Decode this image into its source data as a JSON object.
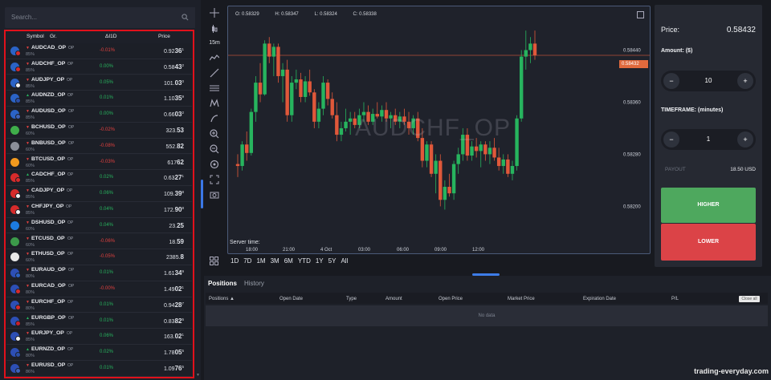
{
  "search": {
    "placeholder": "Search..."
  },
  "list_header": {
    "symbol": "Symbol",
    "group": "Gr.",
    "change": "ΔI1D",
    "price": "Price"
  },
  "assets": [
    {
      "symbol": "AUDCAD_OP",
      "suffix": "OP",
      "payout": "85%",
      "dir": "down",
      "change": "-0.01%",
      "price_main": "0.92",
      "price_big": "36",
      "price_sup": "1",
      "c1": "#2b63c6",
      "c2": "#d62b2b"
    },
    {
      "symbol": "AUDCHF_OP",
      "suffix": "OP",
      "payout": "85%",
      "dir": "down",
      "change": "0.00%",
      "price_main": "0.58",
      "price_big": "43",
      "price_sup": "2",
      "c1": "#2b63c6",
      "c2": "#d62b2b"
    },
    {
      "symbol": "AUDJPY_OP",
      "suffix": "OP",
      "payout": "85%",
      "dir": "down",
      "change": "0.05%",
      "price_main": "101.",
      "price_big": "03",
      "price_sup": "0",
      "c1": "#2b63c6",
      "c2": "#f2f2f2"
    },
    {
      "symbol": "AUDNZD_OP",
      "suffix": "OP",
      "payout": "85%",
      "dir": "up",
      "change": "0.01%",
      "price_main": "1.10",
      "price_big": "35",
      "price_sup": "9",
      "c1": "#2b63c6",
      "c2": "#2b4fa8"
    },
    {
      "symbol": "AUDUSD_OP",
      "suffix": "OP",
      "payout": "85%",
      "dir": "down",
      "change": "0.00%",
      "price_main": "0.66",
      "price_big": "03",
      "price_sup": "2",
      "c1": "#2b63c6",
      "c2": "#3e62b8"
    },
    {
      "symbol": "BCHUSD_OP",
      "suffix": "OP",
      "payout": "60%",
      "dir": "down",
      "change": "-0.02%",
      "price_main": "323.",
      "price_big": "53",
      "price_sup": "",
      "c1": "#3fae4a",
      "c2": ""
    },
    {
      "symbol": "BNBUSD_OP",
      "suffix": "OP",
      "payout": "60%",
      "dir": "down",
      "change": "-0.08%",
      "price_main": "552.",
      "price_big": "82",
      "price_sup": "",
      "c1": "#8b8f99",
      "c2": ""
    },
    {
      "symbol": "BTCUSD_OP",
      "suffix": "OP",
      "payout": "60%",
      "dir": "down",
      "change": "-0.03%",
      "price_main": "617",
      "price_big": "62",
      "price_sup": "",
      "c1": "#f29a1e",
      "c2": ""
    },
    {
      "symbol": "CADCHF_OP",
      "suffix": "OP",
      "payout": "85%",
      "dir": "up",
      "change": "0.02%",
      "price_main": "0.63",
      "price_big": "27",
      "price_sup": "1",
      "c1": "#d62b2b",
      "c2": "#d62b2b"
    },
    {
      "symbol": "CADJPY_OP",
      "suffix": "OP",
      "payout": "85%",
      "dir": "down",
      "change": "0.06%",
      "price_main": "109.",
      "price_big": "39",
      "price_sup": "8",
      "c1": "#d62b2b",
      "c2": "#f2f2f2"
    },
    {
      "symbol": "CHFJPY_OP",
      "suffix": "OP",
      "payout": "85%",
      "dir": "down",
      "change": "0.04%",
      "price_main": "172.",
      "price_big": "90",
      "price_sup": "8",
      "c1": "#d62b2b",
      "c2": "#f2f2f2"
    },
    {
      "symbol": "DSHUSD_OP",
      "suffix": "OP",
      "payout": "60%",
      "dir": "down",
      "change": "0.04%",
      "price_main": "23.",
      "price_big": "25",
      "price_sup": "",
      "c1": "#1c7be0",
      "c2": ""
    },
    {
      "symbol": "ETCUSD_OP",
      "suffix": "OP",
      "payout": "60%",
      "dir": "down",
      "change": "-0.06%",
      "price_main": "18.",
      "price_big": "59",
      "price_sup": "",
      "c1": "#3c9a4a",
      "c2": ""
    },
    {
      "symbol": "ETHUSD_OP",
      "suffix": "OP",
      "payout": "60%",
      "dir": "down",
      "change": "-0.05%",
      "price_main": "2385.",
      "price_big": "8",
      "price_sup": "",
      "c1": "#e8e8e8",
      "c2": ""
    },
    {
      "symbol": "EURAUD_OP",
      "suffix": "OP",
      "payout": "80%",
      "dir": "down",
      "change": "0.01%",
      "price_main": "1.61",
      "price_big": "34",
      "price_sup": "9",
      "c1": "#2d4fb5",
      "c2": "#2b63c6"
    },
    {
      "symbol": "EURCAD_OP",
      "suffix": "OP",
      "payout": "80%",
      "dir": "down",
      "change": "-0.00%",
      "price_main": "1.49",
      "price_big": "02",
      "price_sup": "1",
      "c1": "#2d4fb5",
      "c2": "#d62b2b"
    },
    {
      "symbol": "EURCHF_OP",
      "suffix": "OP",
      "payout": "80%",
      "dir": "down",
      "change": "0.01%",
      "price_main": "0.94",
      "price_big": "28",
      "price_sup": "7",
      "c1": "#2d4fb5",
      "c2": "#d62b2b"
    },
    {
      "symbol": "EURGBP_OP",
      "suffix": "OP",
      "payout": "85%",
      "dir": "up",
      "change": "0.01%",
      "price_main": "0.83",
      "price_big": "82",
      "price_sup": "5",
      "c1": "#2d4fb5",
      "c2": "#c8202a"
    },
    {
      "symbol": "EURJPY_OP",
      "suffix": "OP",
      "payout": "85%",
      "dir": "down",
      "change": "0.06%",
      "price_main": "163.",
      "price_big": "02",
      "price_sup": "1",
      "c1": "#2d4fb5",
      "c2": "#f2f2f2"
    },
    {
      "symbol": "EURNZD_OP",
      "suffix": "OP",
      "payout": "80%",
      "dir": "up",
      "change": "0.02%",
      "price_main": "1.78",
      "price_big": "05",
      "price_sup": "5",
      "c1": "#2d4fb5",
      "c2": "#2b4fa8"
    },
    {
      "symbol": "EURUSD_OP",
      "suffix": "OP",
      "payout": "86%",
      "dir": "down",
      "change": "0.01%",
      "price_main": "1.09",
      "price_big": "76",
      "price_sup": "5",
      "c1": "#2d4fb5",
      "c2": "#3e62b8"
    }
  ],
  "toolbar": {
    "timeframe": "15m"
  },
  "chart": {
    "open_label": "O:",
    "open": "0.58329",
    "high_label": "H:",
    "high": "0.58347",
    "low_label": "L:",
    "low": "0.58324",
    "close_label": "C:",
    "close": "0.58338",
    "watermark": "AUDCHF_OP",
    "server_time_label": "Server time:",
    "x_ticks": [
      "18:00",
      "21:00",
      "4 Oct",
      "03:00",
      "06:00",
      "09:00",
      "12:00"
    ],
    "y_ticks": [
      "0.58440",
      "0.58360",
      "0.58280",
      "0.58200"
    ],
    "current_price": "0.58432",
    "ranges": [
      "1D",
      "7D",
      "1M",
      "3M",
      "6M",
      "YTD",
      "1Y",
      "5Y",
      "All"
    ]
  },
  "chart_data": {
    "type": "candlestick",
    "title": "AUDCHF_OP",
    "x_ticks": [
      "18:00",
      "21:00",
      "4 Oct",
      "03:00",
      "06:00",
      "09:00",
      "12:00"
    ],
    "ylim": [
      0.5815,
      0.5848
    ],
    "y_ticks": [
      0.5844,
      0.5836,
      0.5828,
      0.582
    ],
    "current_price": 0.58432,
    "candles": [
      [
        0.58265,
        0.5828,
        0.58245,
        0.58262
      ],
      [
        0.58262,
        0.583,
        0.58255,
        0.58295
      ],
      [
        0.58295,
        0.58315,
        0.5827,
        0.58282
      ],
      [
        0.58282,
        0.5835,
        0.58278,
        0.58345
      ],
      [
        0.58345,
        0.584,
        0.5833,
        0.5839
      ],
      [
        0.5839,
        0.5842,
        0.5836,
        0.58372
      ],
      [
        0.58372,
        0.58455,
        0.5837,
        0.5845
      ],
      [
        0.5845,
        0.5846,
        0.5842,
        0.5843
      ],
      [
        0.5843,
        0.5845,
        0.584,
        0.58445
      ],
      [
        0.58445,
        0.5845,
        0.5839,
        0.584
      ],
      [
        0.584,
        0.5842,
        0.5836,
        0.5841
      ],
      [
        0.5841,
        0.58425,
        0.5833,
        0.5834
      ],
      [
        0.5834,
        0.584,
        0.5833,
        0.5839
      ],
      [
        0.5839,
        0.5841,
        0.5838,
        0.58395
      ],
      [
        0.58395,
        0.58405,
        0.5836,
        0.58368
      ],
      [
        0.58368,
        0.584,
        0.5836,
        0.58392
      ],
      [
        0.58392,
        0.5841,
        0.5837,
        0.58375
      ],
      [
        0.58375,
        0.5838,
        0.5832,
        0.5833
      ],
      [
        0.5833,
        0.5836,
        0.5832,
        0.5835
      ],
      [
        0.5835,
        0.584,
        0.5834,
        0.5839
      ],
      [
        0.5839,
        0.58395,
        0.58355,
        0.58365
      ],
      [
        0.58365,
        0.58375,
        0.58335,
        0.5834
      ],
      [
        0.5834,
        0.5836,
        0.583,
        0.5831
      ],
      [
        0.5831,
        0.5833,
        0.583,
        0.5832
      ],
      [
        0.5832,
        0.5835,
        0.58315,
        0.5833
      ],
      [
        0.5833,
        0.58345,
        0.5831,
        0.58335
      ],
      [
        0.58335,
        0.58345,
        0.5832,
        0.58325
      ],
      [
        0.58325,
        0.5835,
        0.5832,
        0.5834
      ],
      [
        0.5834,
        0.5836,
        0.5833,
        0.58345
      ],
      [
        0.58345,
        0.58355,
        0.58325,
        0.5833
      ],
      [
        0.5833,
        0.5835,
        0.58325,
        0.58342
      ],
      [
        0.58342,
        0.5836,
        0.58335,
        0.58338
      ],
      [
        0.58338,
        0.58355,
        0.5833,
        0.58348
      ],
      [
        0.58348,
        0.5836,
        0.5833,
        0.58335
      ],
      [
        0.58335,
        0.58345,
        0.5832,
        0.5834
      ],
      [
        0.5834,
        0.5835,
        0.58325,
        0.5833
      ],
      [
        0.5833,
        0.58345,
        0.5832,
        0.58338
      ],
      [
        0.58338,
        0.5835,
        0.58325,
        0.5833
      ],
      [
        0.5833,
        0.58345,
        0.5831,
        0.5832
      ],
      [
        0.5832,
        0.5834,
        0.5831,
        0.58335
      ],
      [
        0.58335,
        0.58345,
        0.583,
        0.58305
      ],
      [
        0.58305,
        0.5832,
        0.5826,
        0.5827
      ],
      [
        0.5827,
        0.583,
        0.5826,
        0.58295
      ],
      [
        0.58295,
        0.583,
        0.58245,
        0.5825
      ],
      [
        0.5825,
        0.5828,
        0.5822,
        0.5827
      ],
      [
        0.5827,
        0.5828,
        0.582,
        0.5821
      ],
      [
        0.5821,
        0.5824,
        0.58195,
        0.5823
      ],
      [
        0.5823,
        0.5825,
        0.58215,
        0.5822
      ],
      [
        0.5822,
        0.5827,
        0.5821,
        0.58265
      ],
      [
        0.58265,
        0.5829,
        0.5825,
        0.5828
      ],
      [
        0.5828,
        0.5832,
        0.5827,
        0.5831
      ],
      [
        0.5831,
        0.5832,
        0.5827,
        0.58278
      ],
      [
        0.58278,
        0.583,
        0.5827,
        0.58292
      ],
      [
        0.58292,
        0.58305,
        0.58275,
        0.58285
      ],
      [
        0.58285,
        0.583,
        0.5826,
        0.58295
      ],
      [
        0.58295,
        0.583,
        0.5827,
        0.5828
      ],
      [
        0.5828,
        0.583,
        0.58265,
        0.5829
      ],
      [
        0.5829,
        0.58305,
        0.5827,
        0.58275
      ],
      [
        0.58275,
        0.5829,
        0.58255,
        0.58262
      ],
      [
        0.58262,
        0.5828,
        0.5825,
        0.58272
      ],
      [
        0.58272,
        0.5828,
        0.58245,
        0.5825
      ],
      [
        0.5825,
        0.5827,
        0.5824,
        0.58262
      ],
      [
        0.58262,
        0.5834,
        0.58255,
        0.58335
      ],
      [
        0.58335,
        0.5844,
        0.5833,
        0.5843
      ],
      [
        0.5843,
        0.5847,
        0.5841,
        0.5844
      ],
      [
        0.5844,
        0.5846,
        0.5842,
        0.5845
      ],
      [
        0.5845,
        0.5847,
        0.58425,
        0.58432
      ]
    ]
  },
  "trade": {
    "price_label": "Price:",
    "price": "0.58432",
    "amount_label": "Amount: ($)",
    "amount": "10",
    "timeframe_label": "TIMEFRAME: (minutes)",
    "timeframe": "1",
    "minus": "−",
    "plus": "+",
    "payout_label": "PAYOUT",
    "payout": "18.50 USD",
    "higher": "HIGHER",
    "lower": "LOWER"
  },
  "bottom": {
    "tabs": [
      "Positions",
      "History"
    ],
    "columns": [
      "Positions ▲",
      "Open Date",
      "Type",
      "Amount",
      "Open Price",
      "Market Price",
      "Expiration Date",
      "P/L"
    ],
    "close_all": "Close all",
    "empty": "No data"
  },
  "watermark": "trading-everyday.com"
}
